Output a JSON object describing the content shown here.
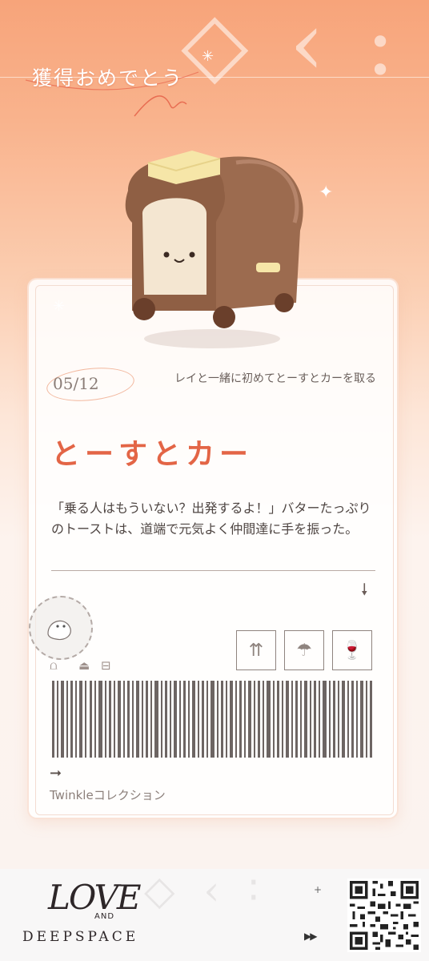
{
  "header": {
    "title": "獲得おめでとう"
  },
  "item": {
    "number": "05/12",
    "condition": "レイと一緒に初めてとーすとカーを取る",
    "name": "とーすとカー",
    "quote": "「乗る人はもういない？出発するよ！」バターたっぷりのトーストは、道端で元気よく仲間達に手を振った。"
  },
  "card": {
    "collection_label": "Twinkleコレクション"
  },
  "footer": {
    "logo_love": "LOVE",
    "logo_and": "AND",
    "logo_deepspace": "DEEPSPACE"
  },
  "icons": [
    "down-arrow-icon",
    "this-way-up-icon",
    "keep-dry-icon",
    "fragile-icon",
    "right-arrow-icon",
    "wash-icon",
    "iron-icon",
    "dry-icon",
    "fast-forward-icon",
    "qr-code"
  ],
  "colors": {
    "accent": "#e36546",
    "header_top": "#f7a47a",
    "text": "#4e4542"
  }
}
